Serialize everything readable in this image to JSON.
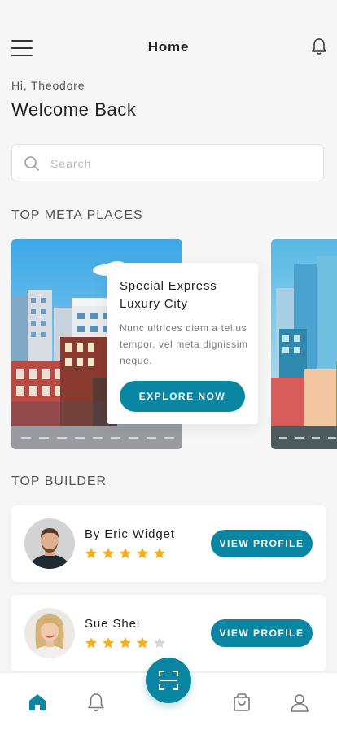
{
  "header": {
    "title": "Home",
    "menu_icon": "hamburger-menu-icon",
    "notification_icon": "bell-icon"
  },
  "greeting": {
    "hi": "Hi, Theodore",
    "welcome": "Welcome Back"
  },
  "search": {
    "placeholder": "Search",
    "icon": "search-icon"
  },
  "places_section": {
    "title": "TOP META PLACES",
    "featured": {
      "title": "Special Express Luxury City",
      "description": "Nunc ultrices diam a tellus tempor, vel meta dignissim neque.",
      "button": "EXPLORE NOW"
    }
  },
  "builders_section": {
    "title": "TOP BUILDER",
    "builders": [
      {
        "name": "By Eric Widget",
        "rating": 5,
        "max_rating": 5,
        "button": "VIEW PROFILE"
      },
      {
        "name": "Sue Shei",
        "rating": 4,
        "max_rating": 5,
        "button": "VIEW PROFILE"
      }
    ]
  },
  "bottom_nav": {
    "items": [
      "home-icon",
      "bell-icon",
      "scan-icon",
      "shopping-bag-icon",
      "user-icon"
    ],
    "active": "home-icon"
  },
  "colors": {
    "accent": "#0a86a3",
    "star": "#f2b01e",
    "star_empty": "#d6d6d6"
  }
}
